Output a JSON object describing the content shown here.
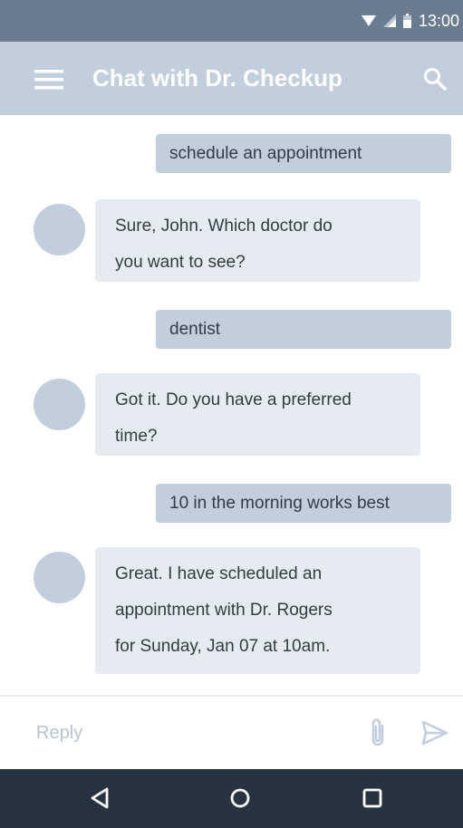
{
  "status_bar": {
    "time": "13:00",
    "icons": [
      "wifi-icon",
      "signal-icon",
      "battery-icon"
    ]
  },
  "app_bar": {
    "title": "Chat with Dr. Checkup",
    "menu_icon": "hamburger-menu-icon",
    "search_icon": "search-icon"
  },
  "messages": [
    {
      "from": "user",
      "text": "schedule an appointment"
    },
    {
      "from": "bot",
      "lines": [
        "Sure, John. Which doctor do",
        "you want to see?"
      ]
    },
    {
      "from": "user",
      "text": "dentist"
    },
    {
      "from": "bot",
      "lines": [
        "Got it. Do you have a preferred",
        "time?"
      ]
    },
    {
      "from": "user",
      "text": "10 in the morning works best"
    },
    {
      "from": "bot",
      "lines": [
        "Great. I have scheduled an",
        "appointment with Dr. Rogers",
        "for Sunday, Jan 07 at 10am."
      ]
    }
  ],
  "composer": {
    "placeholder": "Reply",
    "value": "",
    "attach_icon": "paperclip-icon",
    "send_icon": "send-icon"
  },
  "nav_bar": {
    "buttons": [
      "back-icon",
      "home-icon",
      "recents-icon"
    ]
  },
  "colors": {
    "status_bar": "#6b7c91",
    "app_bar": "#c3cedd",
    "user_bubble": "#c3cedd",
    "bot_bubble": "#e6ebf2",
    "avatar": "#c3cedd",
    "nav_bar": "#283341",
    "text": "#333b45"
  }
}
